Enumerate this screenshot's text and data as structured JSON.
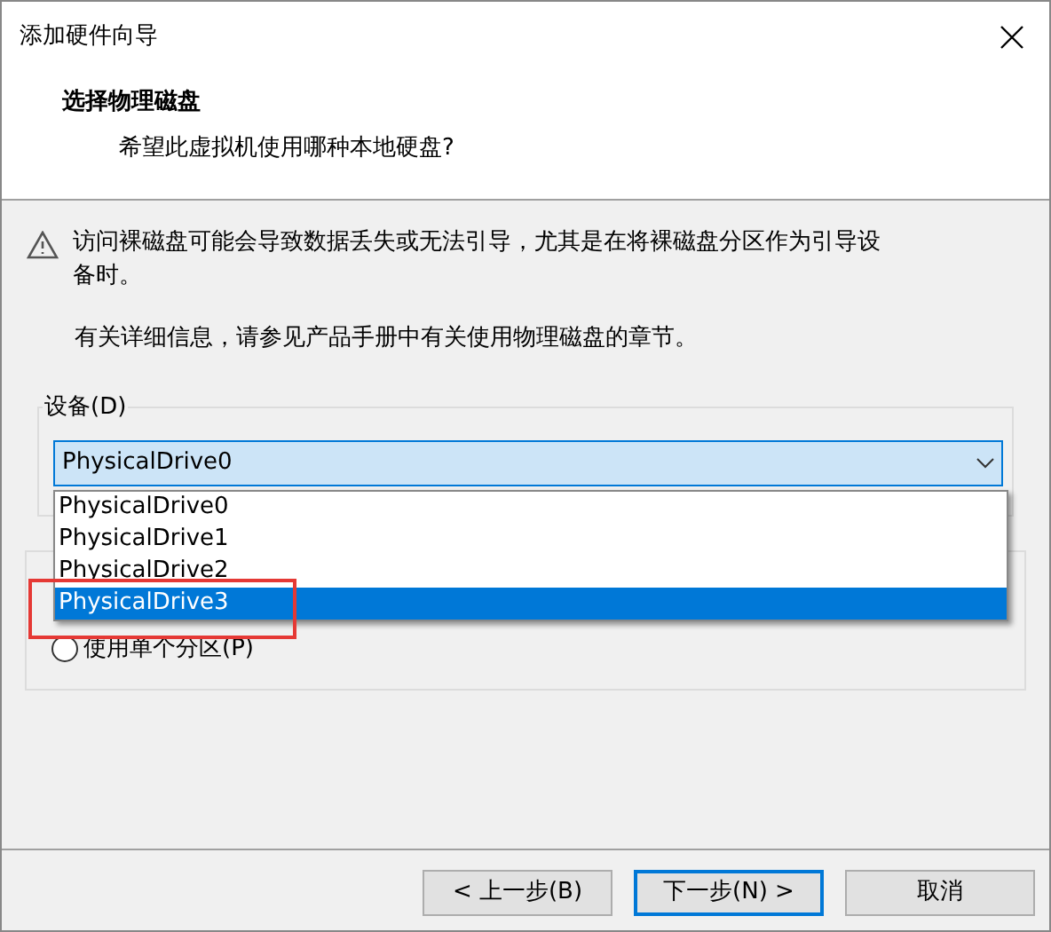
{
  "window": {
    "title": "添加硬件向导"
  },
  "header": {
    "title": "选择物理磁盘",
    "subtitle": "希望此虚拟机使用哪种本地硬盘?"
  },
  "warning": {
    "text": "访问裸磁盘可能会导致数据丢失或无法引导，尤其是在将裸磁盘分区作为引导设备时。"
  },
  "info": "有关详细信息，请参见产品手册中有关使用物理磁盘的章节。",
  "device_group": {
    "label": "设备(D)",
    "combo_value": "PhysicalDrive0",
    "options": [
      {
        "label": "PhysicalDrive0",
        "selected": false
      },
      {
        "label": "PhysicalDrive1",
        "selected": false
      },
      {
        "label": "PhysicalDrive2",
        "selected": false
      },
      {
        "label": "PhysicalDrive3",
        "selected": true
      }
    ]
  },
  "usage_group": {
    "radios": [
      {
        "label": "使用单个分区(P)",
        "selected": false
      }
    ]
  },
  "buttons": [
    {
      "label": "< 上一步(B)",
      "default": false
    },
    {
      "label": "下一步(N) >",
      "default": true
    },
    {
      "label": "取消",
      "default": false
    }
  ]
}
